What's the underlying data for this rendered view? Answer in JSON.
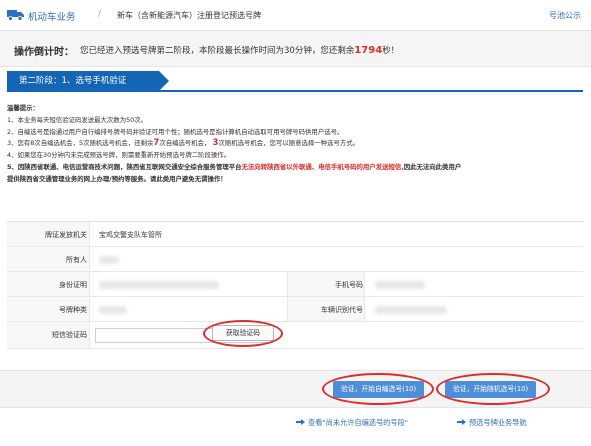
{
  "header": {
    "crumb_root": "机动车业务",
    "crumb_separator": "/",
    "crumb_current": "新车（含新能源汽车）注册登记预选号牌",
    "notice_link": "号池公示"
  },
  "countdown": {
    "label": "操作倒计时：",
    "message_pre": "您已经进入预选号牌第二阶段，本阶段最长操作时间为30分钟，您还剩余",
    "seconds": "1794",
    "message_post": "秒！"
  },
  "stage": {
    "title": "第二阶段：1、选号手机验证"
  },
  "tips": {
    "title": "温馨提示：",
    "line1": "1、本业务每天短信验证码发送最大次数为50次。",
    "line2": "2、自编选号是指通过用户自行编排号牌号码并验证可用个性；随机选号是指计算机自动选取可用号牌号码供用户选号。",
    "line3_a": "3、您有8次自编选机会，5次随机选号机会，还剩余",
    "line3_n1": "7",
    "line3_b": "次自编选号机会，",
    "line3_n2": "3",
    "line3_c": "次随机选号机会，您可以随意选择一种选号方式。",
    "line4": "4、如果您在30分钟内未完成预选号牌，则需要重新开始预选号牌二阶段操作。",
    "line5_a": "5、因陕西省联通、电信运营商技术问题，陕西省互联网交通安全综合服务管理平台",
    "line5_red": "无法向转陕西省以外联通、电信手机号码的用户发送短信,",
    "line5_b": "因此无法向此类用户",
    "line6": "提供陕西省交通管理业务的网上办理/预约等服务。请此类用户避免无谓操作！"
  },
  "form": {
    "issuer_label": "牌证发放机关",
    "issuer_value": "宝鸡交警支队车管所",
    "owner_label": "所有人",
    "id_label": "身份证明",
    "phone_label": "手机号码",
    "plate_type_label": "号牌种类",
    "vin_label": "车辆识别代号",
    "sms_label": "短信验证码",
    "get_code_button": "获取验证码"
  },
  "buttons": {
    "custom_select": "验证，开始自编选号(10)",
    "random_select": "验证，开始随机选号(10)"
  },
  "footer": {
    "link1": "查看\"尚未允许自编选号的号段\"",
    "link2": "预选号牌业务导航"
  },
  "colors": {
    "brand_blue": "#1565b7",
    "link_blue": "#2e6fc2",
    "button_blue": "#4c8ed8",
    "alert_red": "#e12b2b"
  },
  "icons": [
    "truck-icon",
    "chevron-right-icon",
    "hand-pointer-icon"
  ]
}
